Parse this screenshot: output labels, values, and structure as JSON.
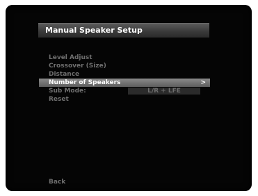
{
  "header": {
    "title": "Manual Speaker Setup"
  },
  "menu": {
    "items": [
      {
        "label": "Level Adjust"
      },
      {
        "label": "Crossover (Size)"
      },
      {
        "label": "Distance"
      },
      {
        "label": "Number of Speakers",
        "chevron": ">"
      },
      {
        "label": "Sub Mode:",
        "value": "L/R + LFE"
      },
      {
        "label": "Reset"
      }
    ]
  },
  "footer": {
    "back_label": "Back"
  },
  "colors": {
    "background": "#050505",
    "selected_highlight": "#7a7a7a",
    "text_dim": "#6e6e6e",
    "text_bright": "#ffffff"
  }
}
